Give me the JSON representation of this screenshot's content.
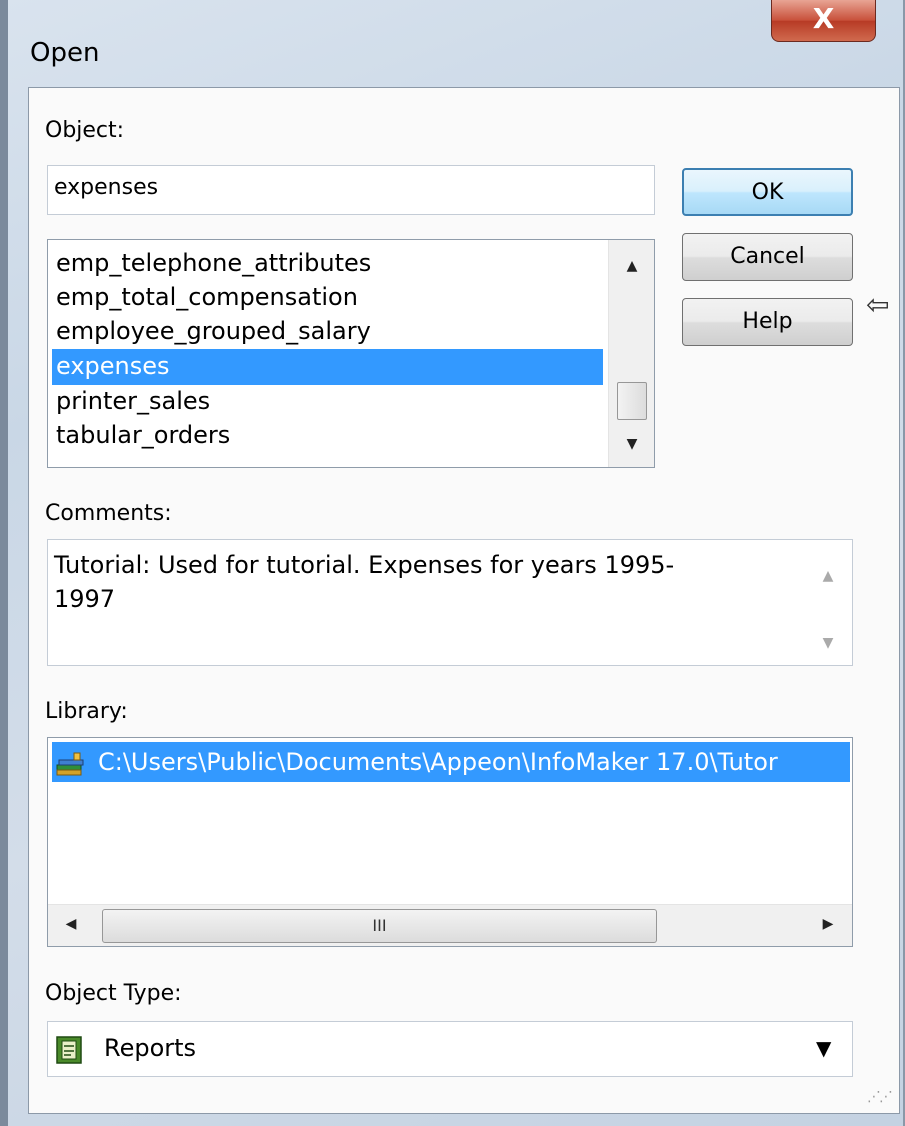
{
  "window": {
    "title": "Open",
    "close_glyph": "X"
  },
  "object": {
    "label": "Object:",
    "value": "expenses",
    "list": [
      "emp_telephone_attributes",
      "emp_total_compensation",
      "employee_grouped_salary",
      "expenses",
      "printer_sales",
      "tabular_orders"
    ],
    "selected": "expenses"
  },
  "buttons": {
    "ok": "OK",
    "cancel": "Cancel",
    "help": "Help"
  },
  "comments": {
    "label": "Comments:",
    "text_line1": "Tutorial: Used for tutorial. Expenses for years 1995-",
    "text_line2": "1997"
  },
  "library": {
    "label": "Library:",
    "path": "C:\\Users\\Public\\Documents\\Appeon\\InfoMaker 17.0\\Tutor",
    "icon": "library-icon"
  },
  "object_type": {
    "label": "Object Type:",
    "value": "Reports",
    "icon": "report-icon"
  },
  "colors": {
    "selection": "#3399ff",
    "default_button_border": "#3c7fb1"
  }
}
